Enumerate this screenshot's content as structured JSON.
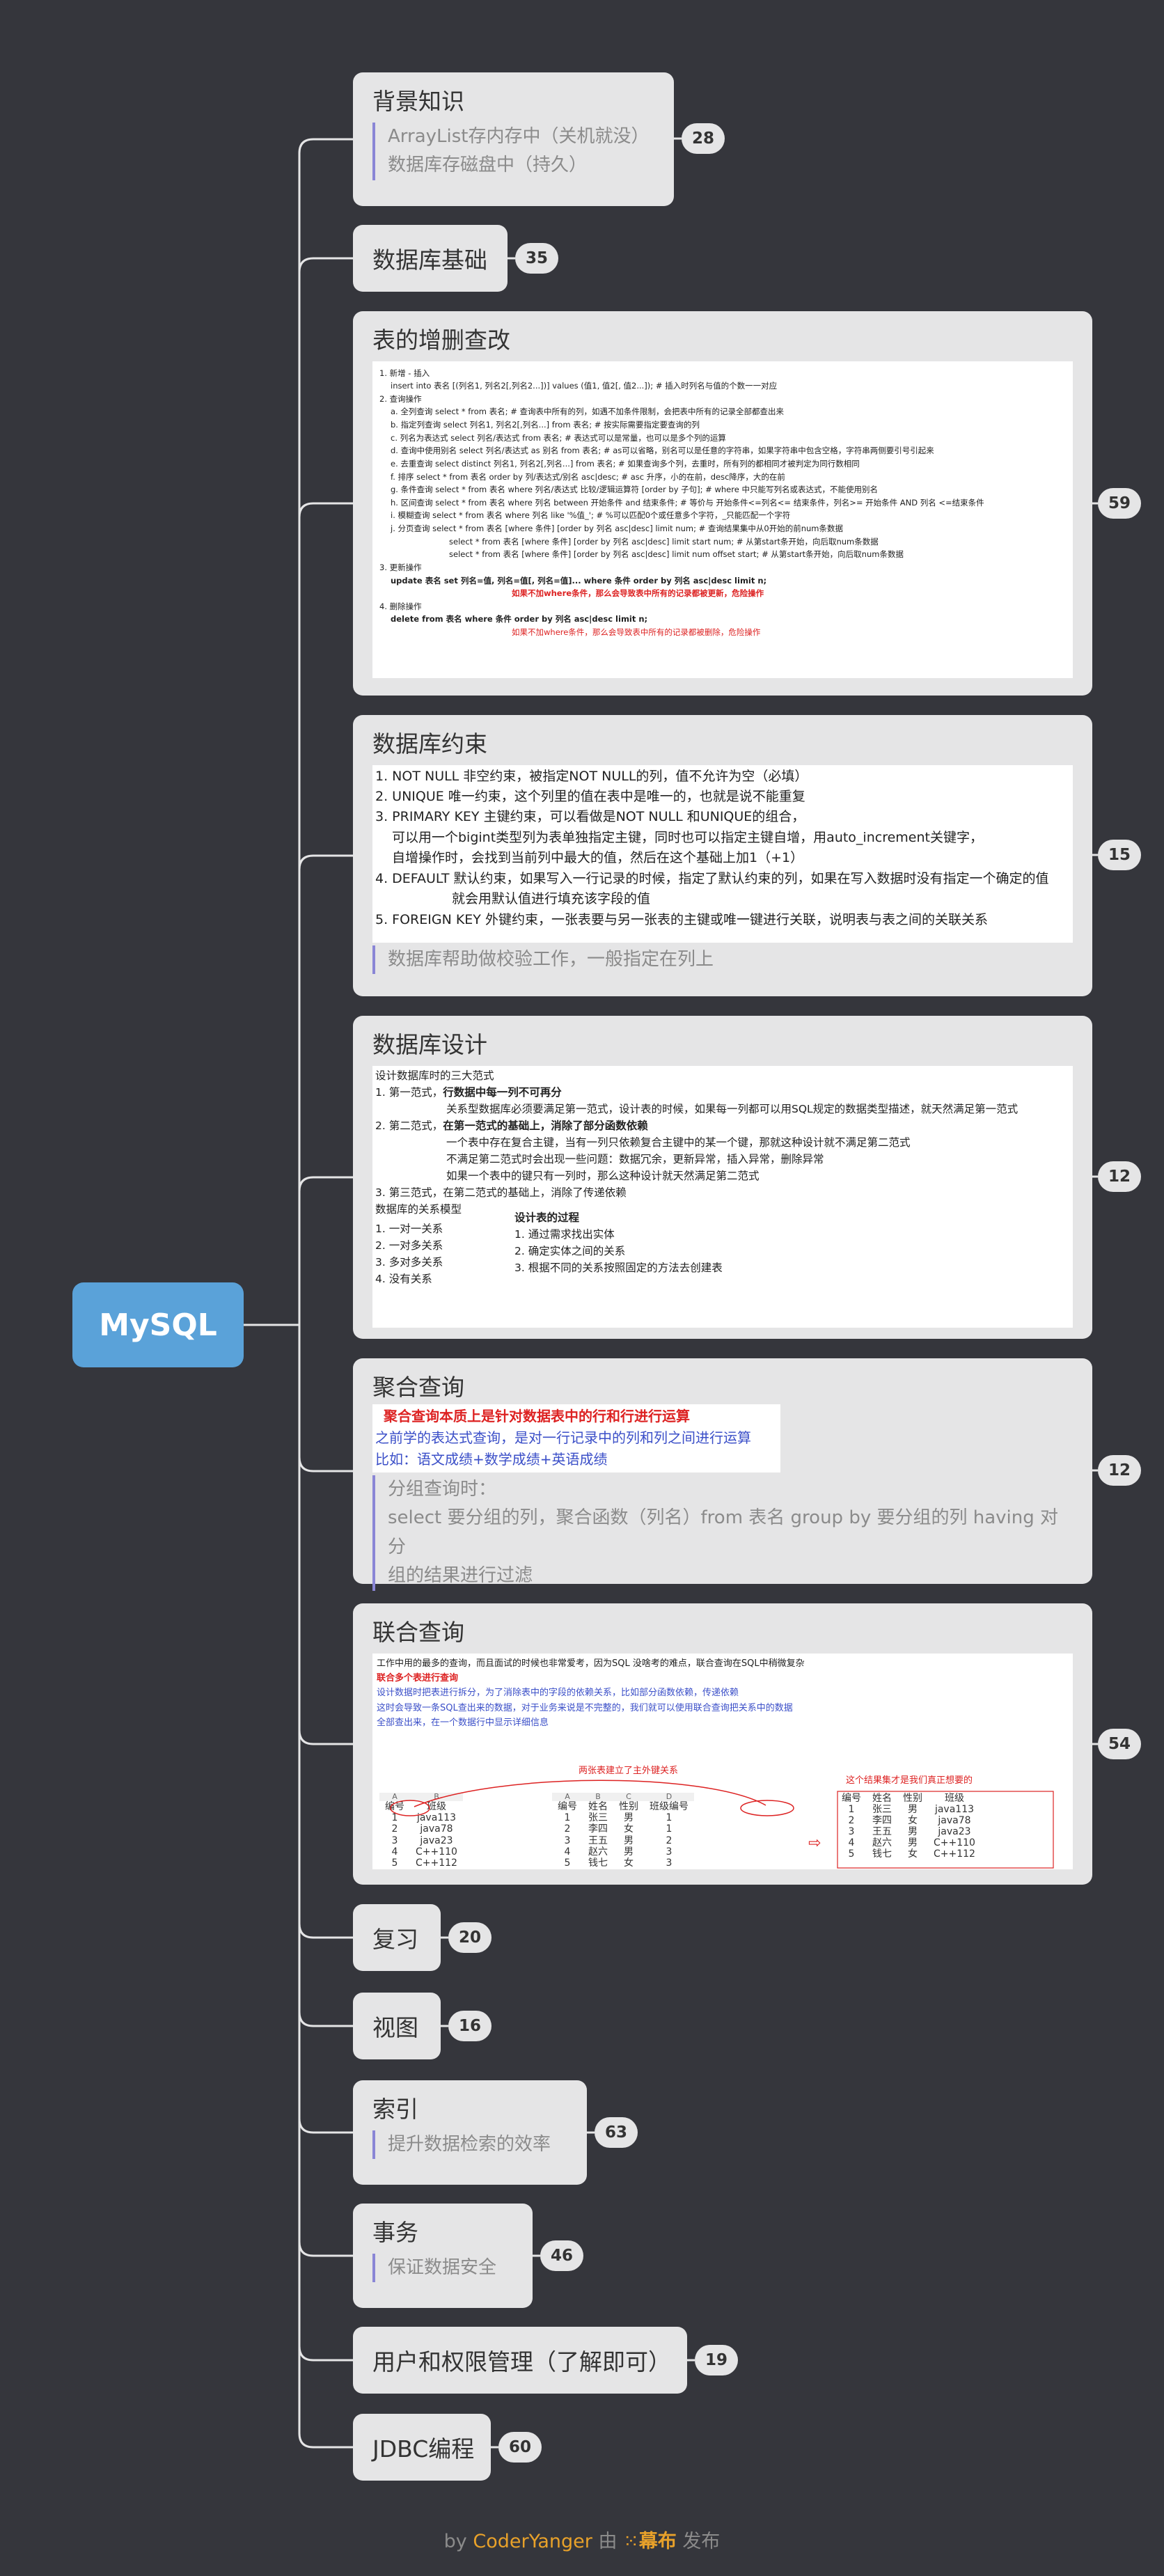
{
  "root": {
    "label": "MySQL"
  },
  "nodes": {
    "background": {
      "title": "背景知识",
      "badge": "28",
      "notes": [
        "ArrayList存内存中（关机就没）",
        "数据库存磁盘中（持久）"
      ]
    },
    "basics": {
      "title": "数据库基础",
      "badge": "35"
    },
    "crud": {
      "title": "表的增删查改",
      "badge": "59",
      "lines": [
        "1. 新增 - 插入",
        "insert into 表名 [(列名1, 列名2[,列名2...])] values (值1, 值2[, 值2...]); # 插入时列名与值的个数一一对应",
        "2. 查询操作",
        "a. 全列查询 select * from 表名;  # 查询表中所有的列，如遇不加条件限制，会把表中所有的记录全部都查出来",
        "b. 指定列查询  select 列名1, 列名2[,列名...] from 表名;  # 按实际需要指定要查询的列",
        "c. 列名为表达式 select 列名/表达式 from 表名; # 表达式可以是常量，也可以是多个列的运算",
        "d. 查询中使用别名 select 列名/表达式 as 别名 from 表名; # as可以省略，别名可以是任意的字符串，如果字符串中包含空格，字符串两侧要引号引起来",
        "e. 去重查询 select distinct 列名1, 列名2[,列名...] from 表名; # 如果查询多个列，去重时，所有列的都相同才被判定为同行数相同",
        "f. 排序  select * from 表名 order by 列/表达式/别名 asc|desc; # asc 升序，小的在前，desc降序，大的在前",
        "g. 条件查询 select * from 表名 where 列名/表达式 比较/逻辑运算符 [order by 子句]; # where 中只能写列名或表达式，不能使用别名",
        "h. 区间查询 select * from 表名 where 列名 between 开始条件 and 结束条件; # 等价与  开始条件<=列名<= 结束条件，列名>= 开始条件  AND 列名 <=结束条件",
        "i. 模糊查询 select * from 表名 where 列名 like '%值_'; # %可以匹配0个或任意多个字符，_只能匹配一个字符",
        "j. 分页查询 select * from 表名 [where 条件] [order by 列名 asc|desc] limit num; # 查询结果集中从0开始的前num条数据",
        "select * from 表名 [where 条件] [order by 列名 asc|desc] limit start num; # 从第start条开始，向后取num条数据",
        "select * from 表名 [where 条件] [order by 列名 asc|desc] limit num offset start; # 从第start条开始，向后取num条数据",
        "3. 更新操作",
        "update 表名 set 列名=值, 列名=值[, 列名=值]... where 条件 order by 列名 asc|desc limit n;",
        "如果不加where条件，那么会导致表中所有的记录都被更新，危险操作",
        "4. 删除操作",
        "delete from 表名 where 条件 order by 列名 asc|desc limit n;",
        "如果不加where条件，那么会导致表中所有的记录都被删除，危险操作"
      ]
    },
    "constraint": {
      "title": "数据库约束",
      "badge": "15",
      "lines": [
        "1. NOT NULL 非空约束，被指定NOT NULL的列，值不允许为空（必填）",
        "2. UNIQUE 唯一约束，这个列里的值在表中是唯一的，也就是说不能重复",
        "3. PRIMARY KEY 主键约束，可以看做是NOT NULL 和UNIQUE的组合，",
        "可以用一个bigint类型列为表单独指定主键，同时也可以指定主键自增，用auto_increment关键字，",
        "自增操作时，会找到当前列中最大的值，然后在这个基础上加1（+1）",
        "4. DEFAULT 默认约束，如果写入一行记录的时候，指定了默认约束的列，如果在写入数据时没有指定一个确定的值",
        "就会用默认值进行填充该字段的值",
        "5. FOREIGN KEY 外键约束，一张表要与另一张表的主键或唯一键进行关联，说明表与表之间的关联关系"
      ],
      "note": "数据库帮助做校验工作，一般指定在列上"
    },
    "design": {
      "title": "数据库设计",
      "badge": "12",
      "lines": [
        "设计数据库时的三大范式",
        "1. 第一范式，",
        "行数据中每一列不可再分",
        "关系型数据库必须要满足第一范式，设计表的时候，如果每一列都可以用SQL规定的数据类型描述，就天然满足第一范式",
        "2. 第二范式，",
        "在第一范式的基础上，消除了部分函数依赖",
        "一个表中存在复合主键，当有一列只依赖复合主键中的某一个键，那就这种设计就不满足第二范式",
        "不满足第二范式时会出现一些问题：数据冗余，更新异常，插入异常，删除异常",
        "如果一个表中的键只有一列时，那么这种设计就天然满足第二范式",
        "3. 第三范式，在第二范式的基础上，消除了传递依赖",
        "数据库的关系模型"
      ],
      "models": [
        "1. 一对一关系",
        "2. 一对多关系",
        "3. 多对多关系",
        "4. 没有关系"
      ],
      "process_title": "设计表的过程",
      "process": [
        "1. 通过需求找出实体",
        "2. 确定实体之间的关系",
        "3. 根据不同的关系按照固定的方法去创建表"
      ]
    },
    "aggregate": {
      "title": "聚合查询",
      "badge": "12",
      "img_lines": [
        "聚合查询本质上是针对数据表中的行和行进行运算",
        "之前学的表达式查询，是对一行记录中的列和列之间进行运算",
        "比如：语文成绩+数学成绩+英语成绩"
      ],
      "note_lines": [
        "分组查询时：",
        "select 要分组的列，聚合函数（列名）from 表名 group by 要分组的列 having 对分",
        "组的结果进行过滤"
      ]
    },
    "join": {
      "title": "联合查询",
      "badge": "54",
      "lines": [
        "工作中用的最多的查询，而且面试的时候也非常爱考，因为SQL 没啥考的难点，联合查询在SQL中稍微复杂",
        "联合多个表进行查询",
        "设计数据时把表进行拆分，为了消除表中的字段的依赖关系，比如部分函数依赖，传递依赖",
        "这时会导致一条SQL查出来的数据，对于业务来说是不完整的，我们就可以使用联合查询把关系中的数据",
        "全部查出来，在一个数据行中显示详细信息"
      ],
      "annot1": "两张表建立了主外键关系",
      "annot2": "这个结果集才是我们真正想要的",
      "table_a_cols": [
        "A",
        "B"
      ],
      "table_a_head": [
        "编号",
        "班级"
      ],
      "table_a": [
        [
          "1",
          "java113"
        ],
        [
          "2",
          "java78"
        ],
        [
          "3",
          "java23"
        ],
        [
          "4",
          "C++110"
        ],
        [
          "5",
          "C++112"
        ]
      ],
      "table_b_cols": [
        "A",
        "B",
        "C",
        "D"
      ],
      "table_b_head": [
        "编号",
        "姓名",
        "性别",
        "班级编号"
      ],
      "table_b": [
        [
          "1",
          "张三",
          "男",
          "1"
        ],
        [
          "2",
          "李四",
          "女",
          "1"
        ],
        [
          "3",
          "王五",
          "男",
          "2"
        ],
        [
          "4",
          "赵六",
          "男",
          "3"
        ],
        [
          "5",
          "钱七",
          "女",
          "3"
        ]
      ],
      "table_c_head": [
        "编号",
        "姓名",
        "性别",
        "班级"
      ],
      "table_c": [
        [
          "1",
          "张三",
          "男",
          "java113"
        ],
        [
          "2",
          "李四",
          "女",
          "java78"
        ],
        [
          "3",
          "王五",
          "男",
          "java23"
        ],
        [
          "4",
          "赵六",
          "男",
          "C++110"
        ],
        [
          "5",
          "钱七",
          "女",
          "C++112"
        ]
      ]
    },
    "review": {
      "title": "复习",
      "badge": "20"
    },
    "view": {
      "title": "视图",
      "badge": "16"
    },
    "index": {
      "title": "索引",
      "badge": "63",
      "note": "提升数据检索的效率"
    },
    "transaction": {
      "title": "事务",
      "badge": "46",
      "note": "保证数据安全"
    },
    "users": {
      "title": "用户和权限管理（了解即可）",
      "badge": "19"
    },
    "jdbc": {
      "title": "JDBC编程",
      "badge": "60"
    }
  },
  "footer": {
    "by": "by",
    "author": "CoderYanger",
    "mid": "由",
    "brand": "幕布",
    "end": "发布"
  },
  "colors": {
    "background": "#35363c",
    "node": "#e5e5e6",
    "root": "#5aa2d9",
    "line": "#e5e5e6",
    "note_bar": "#8a86d6",
    "accent_red": "#d22222",
    "accent_blue": "#3b4fc8"
  }
}
